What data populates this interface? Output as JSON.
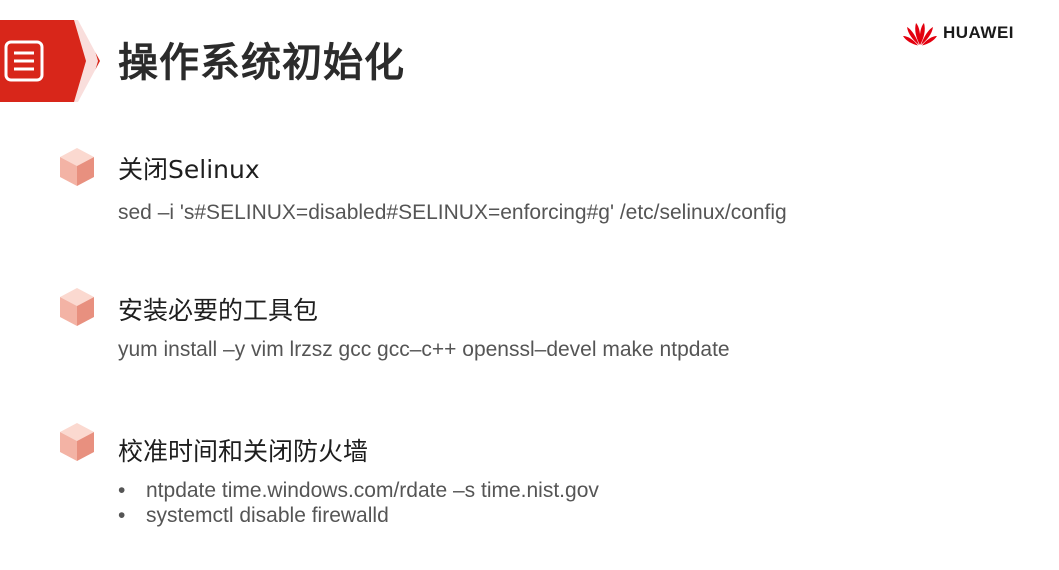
{
  "header": {
    "title": "操作系统初始化",
    "brand": "HUAWEI",
    "icon": "document-icon",
    "accent_color": "#e3000f"
  },
  "sections": [
    {
      "title": "关闭Selinux",
      "body": "sed –i 's#SELINUX=disabled#SELINUX=enforcing#g' /etc/selinux/config"
    },
    {
      "title": "安装必要的工具包",
      "body": "yum install –y vim lrzsz gcc gcc–c++  openssl–devel make ntpdate"
    },
    {
      "title": "校准时间和关闭防火墙",
      "bullets": [
        "ntpdate time.windows.com/rdate –s time.nist.gov",
        "systemctl disable firewalld"
      ]
    }
  ],
  "colors": {
    "title": "#2b2b2b",
    "section_title": "#1e1e1e",
    "body_text": "#555555",
    "cube_light": "#f8c9bf",
    "cube_dark": "#e8907f"
  }
}
